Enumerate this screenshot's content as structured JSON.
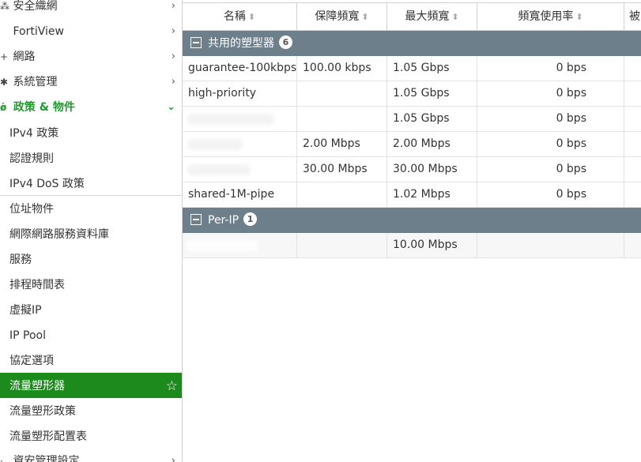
{
  "sidebar": {
    "items": [
      {
        "label": "安全織網",
        "icon": "network-icon",
        "glyph": "⁂",
        "expanded": false
      },
      {
        "label": "FortiView",
        "icon": "chart-icon",
        "glyph": "▪",
        "expanded": false
      },
      {
        "label": "網路",
        "icon": "plug-icon",
        "glyph": "✚",
        "expanded": false
      },
      {
        "label": "系統管理",
        "icon": "gear-icon",
        "glyph": "✱",
        "expanded": false
      },
      {
        "label": "政策 & 物件",
        "icon": "lock-icon",
        "glyph": "🔒",
        "expanded": true
      }
    ],
    "subitems": [
      "IPv4 政策",
      "認證規則",
      "IPv4 DoS 政策",
      "位址物件",
      "網際網路服務資料庫",
      "服務",
      "排程時間表",
      "虛擬IP",
      "IP Pool",
      "協定選項",
      "流量塑形器",
      "流量塑形政策",
      "流量塑形配置表"
    ],
    "active": "流量塑形器",
    "last_item": "資安管理設定",
    "accent_color": "#1c8a1c"
  },
  "table": {
    "columns": [
      "名稱",
      "保障頻寬",
      "最大頻寬",
      "頻寬使用率",
      "被"
    ],
    "groups": [
      {
        "label": "共用的塑型器",
        "count": "6",
        "rows": [
          {
            "name": "guarantee-100kbps",
            "guaranteed": "100.00 kbps",
            "max": "1.05 Gbps",
            "usage": "0 bps"
          },
          {
            "name": "high-priority",
            "guaranteed": "",
            "max": "1.05 Gbps",
            "usage": "0 bps"
          },
          {
            "name": "",
            "guaranteed": "",
            "max": "1.05 Gbps",
            "usage": "0 bps"
          },
          {
            "name": "",
            "guaranteed": "2.00 Mbps",
            "max": "2.00 Mbps",
            "usage": "0 bps"
          },
          {
            "name": "",
            "guaranteed": "30.00 Mbps",
            "max": "30.00 Mbps",
            "usage": "0 bps"
          },
          {
            "name": "shared-1M-pipe",
            "guaranteed": "",
            "max": "1.02 Mbps",
            "usage": "0 bps"
          }
        ]
      },
      {
        "label": "Per-IP",
        "count": "1",
        "rows": [
          {
            "name": "",
            "guaranteed": "",
            "max": "10.00 Mbps",
            "usage": ""
          }
        ]
      }
    ]
  }
}
